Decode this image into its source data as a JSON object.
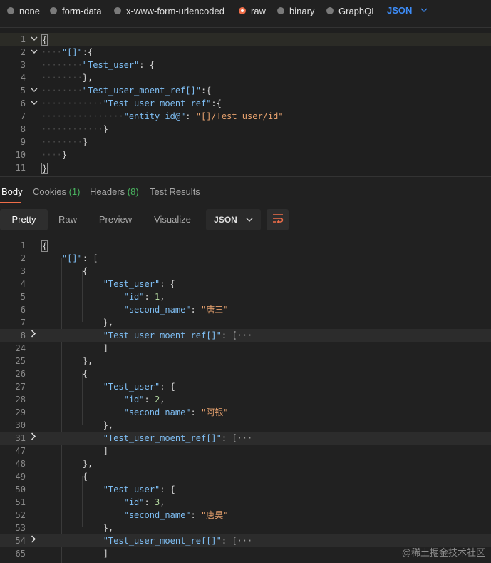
{
  "body_modes": [
    {
      "label": "none",
      "selected": false
    },
    {
      "label": "form-data",
      "selected": false
    },
    {
      "label": "x-www-form-urlencoded",
      "selected": false
    },
    {
      "label": "raw",
      "selected": true
    },
    {
      "label": "binary",
      "selected": false
    },
    {
      "label": "GraphQL",
      "selected": false
    }
  ],
  "raw_format": "JSON",
  "request_lines": [
    {
      "n": "1",
      "fold": true,
      "html": "<span class='cursor-box p'>{</span>"
    },
    {
      "n": "2",
      "fold": true,
      "html": "<span class='ws'>····</span><span class='k'>\"[]\"</span><span class='p'>:{</span>"
    },
    {
      "n": "3",
      "fold": false,
      "html": "<span class='ws'>········</span><span class='k'>\"Test_user\"</span><span class='p'>: {</span>"
    },
    {
      "n": "4",
      "fold": false,
      "html": "<span class='ws'>········</span><span class='p'>},</span>"
    },
    {
      "n": "5",
      "fold": true,
      "html": "<span class='ws'>········</span><span class='k'>\"Test_user_moent_ref[]\"</span><span class='p'>:{</span>"
    },
    {
      "n": "6",
      "fold": true,
      "html": "<span class='ws'>············</span><span class='k'>\"Test_user_moent_ref\"</span><span class='p'>:{</span>"
    },
    {
      "n": "7",
      "fold": false,
      "html": "<span class='ws'>················</span><span class='k'>\"entity_id@\"</span><span class='p'>: </span><span class='s'>\"[]/Test_user/id\"</span>"
    },
    {
      "n": "8",
      "fold": false,
      "html": "<span class='ws'>············</span><span class='p'>}</span>"
    },
    {
      "n": "9",
      "fold": false,
      "html": "<span class='ws'>········</span><span class='p'>}</span>"
    },
    {
      "n": "10",
      "fold": false,
      "html": "<span class='ws'>····</span><span class='p'>}</span>"
    },
    {
      "n": "11",
      "fold": false,
      "html": "<span class='cursor-box p'>}</span>"
    }
  ],
  "response_tabs": {
    "body": "Body",
    "cookies": "Cookies",
    "cookies_count": "(1)",
    "headers": "Headers",
    "headers_count": "(8)",
    "test_results": "Test Results"
  },
  "view_modes": [
    "Pretty",
    "Raw",
    "Preview",
    "Visualize"
  ],
  "response_format": "JSON",
  "response_lines": [
    {
      "n": "1",
      "collapsed": false,
      "html": "<span class='cursor-box p'>{</span>"
    },
    {
      "n": "2",
      "collapsed": false,
      "html": "    <span class='k'>\"[]\"</span><span class='p'>: [</span>"
    },
    {
      "n": "3",
      "collapsed": false,
      "html": "        <span class='p'>{</span>"
    },
    {
      "n": "4",
      "collapsed": false,
      "html": "            <span class='k'>\"Test_user\"</span><span class='p'>: {</span>"
    },
    {
      "n": "5",
      "collapsed": false,
      "html": "                <span class='k'>\"id\"</span><span class='p'>: </span><span class='n'>1</span><span class='p'>,</span>"
    },
    {
      "n": "6",
      "collapsed": false,
      "html": "                <span class='k'>\"second_name\"</span><span class='p'>: </span><span class='s'>\"唐三\"</span>"
    },
    {
      "n": "7",
      "collapsed": false,
      "html": "            <span class='p'>},</span>"
    },
    {
      "n": "8",
      "collapsed": true,
      "html": "            <span class='k'>\"Test_user_moent_ref[]\"</span><span class='p'>: [</span><span class='ellipsis'>···</span>"
    },
    {
      "n": "24",
      "collapsed": false,
      "html": "            <span class='p'>]</span>"
    },
    {
      "n": "25",
      "collapsed": false,
      "html": "        <span class='p'>},</span>"
    },
    {
      "n": "26",
      "collapsed": false,
      "html": "        <span class='p'>{</span>"
    },
    {
      "n": "27",
      "collapsed": false,
      "html": "            <span class='k'>\"Test_user\"</span><span class='p'>: {</span>"
    },
    {
      "n": "28",
      "collapsed": false,
      "html": "                <span class='k'>\"id\"</span><span class='p'>: </span><span class='n'>2</span><span class='p'>,</span>"
    },
    {
      "n": "29",
      "collapsed": false,
      "html": "                <span class='k'>\"second_name\"</span><span class='p'>: </span><span class='s'>\"阿银\"</span>"
    },
    {
      "n": "30",
      "collapsed": false,
      "html": "            <span class='p'>},</span>"
    },
    {
      "n": "31",
      "collapsed": true,
      "html": "            <span class='k'>\"Test_user_moent_ref[]\"</span><span class='p'>: [</span><span class='ellipsis'>···</span>"
    },
    {
      "n": "47",
      "collapsed": false,
      "html": "            <span class='p'>]</span>"
    },
    {
      "n": "48",
      "collapsed": false,
      "html": "        <span class='p'>},</span>"
    },
    {
      "n": "49",
      "collapsed": false,
      "html": "        <span class='p'>{</span>"
    },
    {
      "n": "50",
      "collapsed": false,
      "html": "            <span class='k'>\"Test_user\"</span><span class='p'>: {</span>"
    },
    {
      "n": "51",
      "collapsed": false,
      "html": "                <span class='k'>\"id\"</span><span class='p'>: </span><span class='n'>3</span><span class='p'>,</span>"
    },
    {
      "n": "52",
      "collapsed": false,
      "html": "                <span class='k'>\"second_name\"</span><span class='p'>: </span><span class='s'>\"唐昊\"</span>"
    },
    {
      "n": "53",
      "collapsed": false,
      "html": "            <span class='p'>},</span>"
    },
    {
      "n": "54",
      "collapsed": true,
      "html": "            <span class='k'>\"Test_user_moent_ref[]\"</span><span class='p'>: [</span><span class='ellipsis'>···</span>"
    },
    {
      "n": "65",
      "collapsed": false,
      "html": "            <span class='p'>]</span>"
    }
  ],
  "watermark": "@稀土掘金技术社区",
  "colors": {
    "accent": "#ef6d48",
    "link_blue": "#3d8cf7",
    "count_green": "#49b35f"
  }
}
